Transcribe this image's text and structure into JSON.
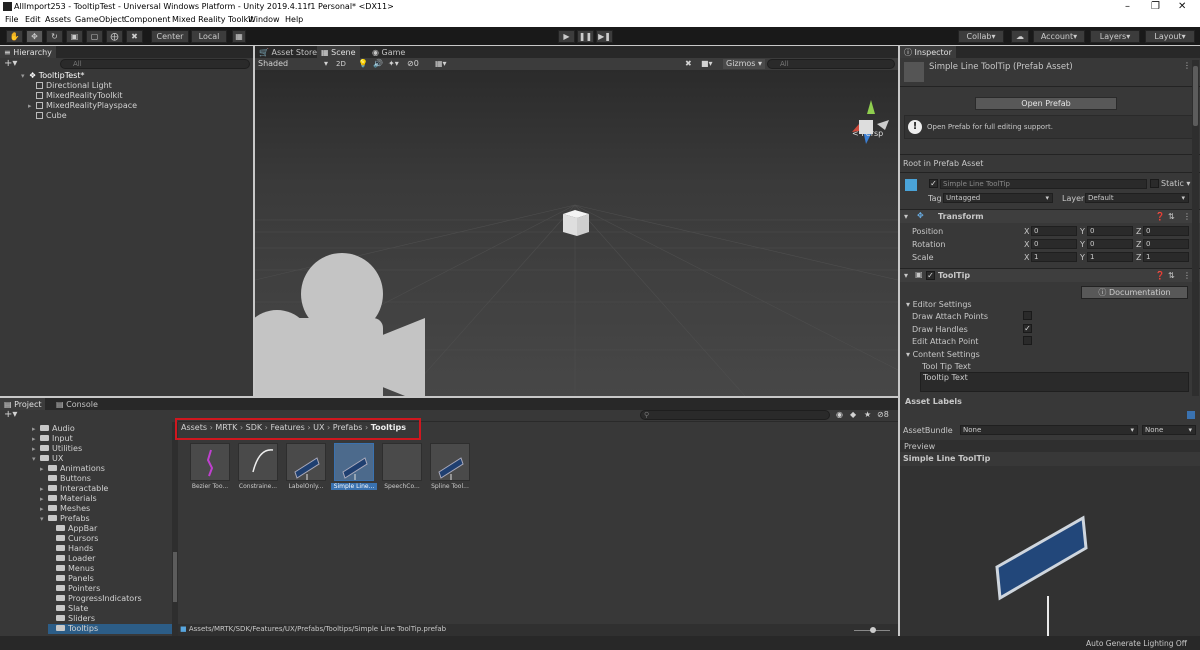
{
  "window": {
    "title": "AllImport253 - TooltipTest - Universal Windows Platform - Unity 2019.4.11f1 Personal* <DX11>"
  },
  "menu": [
    "File",
    "Edit",
    "Assets",
    "GameObject",
    "Component",
    "Mixed Reality Toolkit",
    "Window",
    "Help"
  ],
  "toolbar": {
    "center": "Center",
    "local": "Local",
    "collab": "Collab",
    "account": "Account",
    "layers": "Layers",
    "layout": "Layout"
  },
  "hierarchy": {
    "tab": "Hierarchy",
    "search_placeholder": "All",
    "root": "TooltipTest*",
    "items": [
      "Directional Light",
      "MixedRealityToolkit",
      "MixedRealityPlayspace",
      "Cube"
    ]
  },
  "scene": {
    "tabs": [
      "Asset Store",
      "Scene",
      "Game"
    ],
    "shading": "Shaded",
    "mode2d": "2D",
    "hidden_count": "0",
    "gizmos": "Gizmos",
    "search_placeholder": "All",
    "persp": "Persp"
  },
  "inspector": {
    "tab": "Inspector",
    "asset_title": "Simple Line ToolTip (Prefab Asset)",
    "open_prefab": "Open Prefab",
    "info": "Open Prefab for full editing support.",
    "root_label": "Root in Prefab Asset",
    "object_name": "Simple Line ToolTip",
    "static_label": "Static",
    "tag_label": "Tag",
    "tag_value": "Untagged",
    "layer_label": "Layer",
    "layer_value": "Default",
    "transform": {
      "title": "Transform",
      "position_label": "Position",
      "rotation_label": "Rotation",
      "scale_label": "Scale",
      "axis": [
        "X",
        "Y",
        "Z"
      ],
      "position": [
        "0",
        "0",
        "0"
      ],
      "rotation": [
        "0",
        "0",
        "0"
      ],
      "scale": [
        "1",
        "1",
        "1"
      ]
    },
    "tooltip": {
      "title": "ToolTip",
      "documentation": "Documentation",
      "editor_settings": "Editor Settings",
      "draw_attach_points": "Draw Attach Points",
      "draw_handles": "Draw Handles",
      "edit_attach_point": "Edit Attach Point",
      "content_settings": "Content Settings",
      "tool_tip_text_label": "Tool Tip Text",
      "tool_tip_text_value": "Tooltip Text"
    },
    "asset_labels": "Asset Labels",
    "assetbundle_label": "AssetBundle",
    "assetbundle_value": "None",
    "assetbundle_variant": "None",
    "preview_tab": "Preview",
    "preview_title": "Simple Line ToolTip"
  },
  "project": {
    "tabs": [
      "Project",
      "Console"
    ],
    "tree": [
      {
        "label": "Audio",
        "indent": 1,
        "expanded": false
      },
      {
        "label": "Input",
        "indent": 1,
        "expanded": false
      },
      {
        "label": "Utilities",
        "indent": 1,
        "expanded": false
      },
      {
        "label": "UX",
        "indent": 1,
        "expanded": true
      },
      {
        "label": "Animations",
        "indent": 2,
        "expanded": false
      },
      {
        "label": "Buttons",
        "indent": 2,
        "expanded": null
      },
      {
        "label": "Interactable",
        "indent": 2,
        "expanded": false
      },
      {
        "label": "Materials",
        "indent": 2,
        "expanded": false
      },
      {
        "label": "Meshes",
        "indent": 2,
        "expanded": false
      },
      {
        "label": "Prefabs",
        "indent": 2,
        "expanded": true
      },
      {
        "label": "AppBar",
        "indent": 3,
        "expanded": null
      },
      {
        "label": "Cursors",
        "indent": 3,
        "expanded": null
      },
      {
        "label": "Hands",
        "indent": 3,
        "expanded": null
      },
      {
        "label": "Loader",
        "indent": 3,
        "expanded": null
      },
      {
        "label": "Menus",
        "indent": 3,
        "expanded": null
      },
      {
        "label": "Panels",
        "indent": 3,
        "expanded": null
      },
      {
        "label": "Pointers",
        "indent": 3,
        "expanded": null
      },
      {
        "label": "ProgressIndicators",
        "indent": 3,
        "expanded": null
      },
      {
        "label": "Slate",
        "indent": 3,
        "expanded": null
      },
      {
        "label": "Sliders",
        "indent": 3,
        "expanded": null
      },
      {
        "label": "Tooltips",
        "indent": 3,
        "expanded": null
      }
    ],
    "breadcrumb": [
      "Assets",
      "MRTK",
      "SDK",
      "Features",
      "UX",
      "Prefabs",
      "Tooltips"
    ],
    "hidden_count": "8",
    "assets": [
      "Bezier Too...",
      "Constraine...",
      "LabelOnly...",
      "Simple Line...",
      "SpeechCo...",
      "Spline Tool..."
    ],
    "selected_index": 3,
    "path": "Assets/MRTK/SDK/Features/UX/Prefabs/Tooltips/Simple Line ToolTip.prefab"
  },
  "status": {
    "right": "Auto Generate Lighting Off"
  },
  "colors": {
    "highlight": "#d0171f",
    "selection": "#2c5d87",
    "accent": "#3a72b0"
  }
}
